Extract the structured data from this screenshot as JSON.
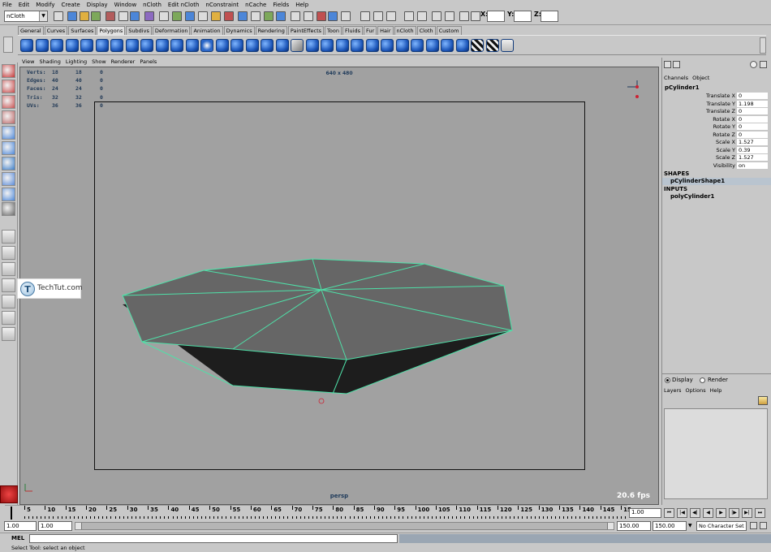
{
  "menubar": {
    "items": [
      "File",
      "Edit",
      "Modify",
      "Create",
      "Display",
      "Window",
      "nCloth",
      "Edit nCloth",
      "nConstraint",
      "nCache",
      "Fields",
      "Help"
    ]
  },
  "statusline": {
    "mode": "nCloth",
    "x_label": "X:",
    "y_label": "Y:",
    "z_label": "Z:",
    "x_value": "",
    "y_value": "",
    "z_value": ""
  },
  "shelf": {
    "tabs": [
      "General",
      "Curves",
      "Surfaces",
      "Polygons",
      "Subdivs",
      "Deformation",
      "Animation",
      "Dynamics",
      "Rendering",
      "PaintEffects",
      "Toon",
      "Fluids",
      "Fur",
      "Hair",
      "nCloth",
      "Cloth",
      "Custom"
    ],
    "active_tab": "Polygons"
  },
  "panel": {
    "menu": [
      "View",
      "Shading",
      "Lighting",
      "Show",
      "Renderer",
      "Panels"
    ]
  },
  "hud": {
    "rows": [
      {
        "label": "Verts:",
        "a": "18",
        "b": "18",
        "c": "0"
      },
      {
        "label": "Edges:",
        "a": "40",
        "b": "40",
        "c": "0"
      },
      {
        "label": "Faces:",
        "a": "24",
        "b": "24",
        "c": "0"
      },
      {
        "label": "Tris:",
        "a": "32",
        "b": "32",
        "c": "0"
      },
      {
        "label": "UVs:",
        "a": "36",
        "b": "36",
        "c": "0"
      }
    ],
    "resolution": "640 x 480",
    "camera": "persp",
    "fps": "20.6 fps"
  },
  "channelbox": {
    "tabs": [
      "Channels",
      "Object"
    ],
    "object": "pCylinder1",
    "attributes": [
      {
        "name": "Translate X",
        "value": "0"
      },
      {
        "name": "Translate Y",
        "value": "1.198"
      },
      {
        "name": "Translate Z",
        "value": "0"
      },
      {
        "name": "Rotate X",
        "value": "0"
      },
      {
        "name": "Rotate Y",
        "value": "0"
      },
      {
        "name": "Rotate Z",
        "value": "0"
      },
      {
        "name": "Scale X",
        "value": "1.527"
      },
      {
        "name": "Scale Y",
        "value": "0.39"
      },
      {
        "name": "Scale Z",
        "value": "1.527"
      },
      {
        "name": "Visibility",
        "value": "on"
      }
    ],
    "shapes_label": "SHAPES",
    "shape": "pCylinderShape1",
    "inputs_label": "INPUTS",
    "input": "polyCylinder1"
  },
  "layers": {
    "display": "Display",
    "render": "Render",
    "menu": [
      "Layers",
      "Options",
      "Help"
    ]
  },
  "timeline": {
    "ticks": [
      "5",
      "10",
      "15",
      "20",
      "25",
      "30",
      "35",
      "40",
      "45",
      "50",
      "55",
      "60",
      "65",
      "70",
      "75",
      "80",
      "85",
      "90",
      "95",
      "100",
      "105",
      "110",
      "115",
      "120",
      "125",
      "130",
      "135",
      "140",
      "145",
      "15"
    ],
    "current_time": "1.00",
    "range_start": "1.00",
    "range_inner_start": "1.00",
    "range_end": "150.00",
    "range_inner_end": "150.00",
    "char_set": "No Character Set"
  },
  "mel": {
    "label": "MEL",
    "help": "Select Tool: select an object"
  },
  "watermark": {
    "text": "TechTut.com",
    "logo_letter": "T"
  },
  "colors": {
    "viewport_bg": "#a1a1a1",
    "wire": "#4fe0a8",
    "top_face": "#666666",
    "side_face": "#1d1d1d",
    "icon_blue": "#1c55b8"
  }
}
